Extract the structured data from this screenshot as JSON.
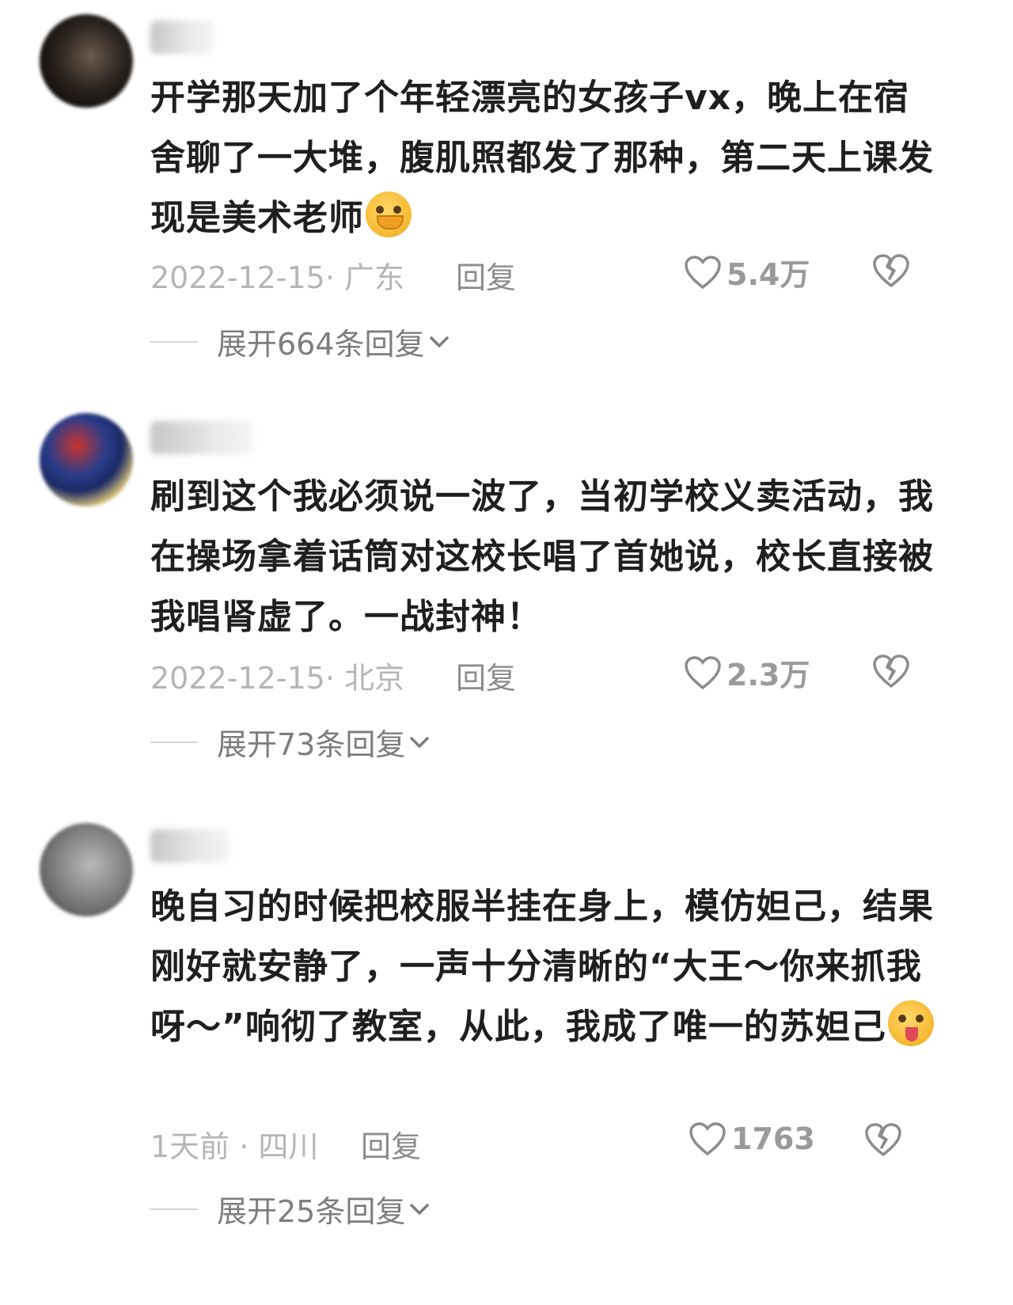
{
  "comments": [
    {
      "text": "开学那天加了个年轻漂亮的女孩子vx，晚上在宿舍聊了一大堆，腹肌照都发了那种，第二天上课发现是美术老师",
      "emoji": "crying-face-emoji",
      "date_location": "2022-12-15· 广东",
      "reply_label": "回复",
      "likes": "5.4万",
      "expand_label": "展开664条回复"
    },
    {
      "text": "刷到这个我必须说一波了，当初学校义卖活动，我在操场拿着话筒对这校长唱了首她说，校长直接被我唱肾虚了。一战封神！",
      "emoji": "",
      "date_location": "2022-12-15· 北京",
      "reply_label": "回复",
      "likes": "2.3万",
      "expand_label": "展开73条回复"
    },
    {
      "text": "晚自习的时候把校服半挂在身上，模仿妲己，结果刚好就安静了，一声十分清晰的“大王～你来抓我呀～”响彻了教室，从此，我成了唯一的苏妲己",
      "emoji": "silly-face-emoji",
      "date_location": "1天前 · 四川",
      "reply_label": "回复",
      "likes": "1763",
      "expand_label": "展开25条回复"
    }
  ],
  "icons": {
    "like": "heart-outline-icon",
    "dislike": "broken-heart-icon",
    "expand": "chevron-down-icon"
  }
}
